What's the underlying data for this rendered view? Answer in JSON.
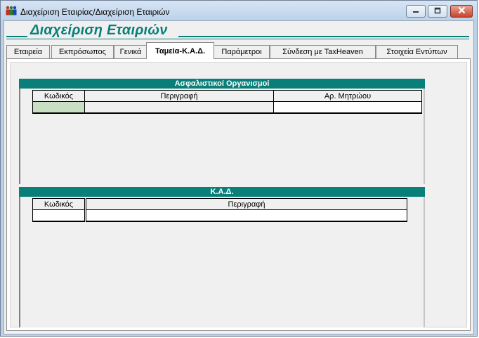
{
  "window": {
    "title": "Διαχείριση Εταιρίας/Διαχείριση Εταιριών"
  },
  "header": {
    "title": "Διαχείριση Εταιριών"
  },
  "tabs": [
    {
      "label": "Εταιρεία"
    },
    {
      "label": "Εκπρόσωπος"
    },
    {
      "label": "Γενικά"
    },
    {
      "label": "Ταμεία-Κ.Α.Δ."
    },
    {
      "label": "Παράμετροι"
    },
    {
      "label": "Σύνδεση με TaxHeaven"
    },
    {
      "label": "Στοιχεία Εντύπων"
    }
  ],
  "active_tab": "Ταμεία-Κ.Α.Δ.",
  "insurance_grid": {
    "caption": "Ασφαλιστικοί Οργανισμοί",
    "columns": [
      "Κωδικός",
      "Περιγραφή",
      "Αρ. Μητρώου"
    ],
    "rows": [
      [
        "",
        "",
        ""
      ]
    ]
  },
  "kad_grid": {
    "caption": "Κ.Α.Δ.",
    "columns": [
      "Κωδικός",
      "Περιγραφή"
    ],
    "rows": [
      [
        "",
        ""
      ]
    ]
  },
  "colors": {
    "accent": "#0a7f7a",
    "selected_cell": "#c9dfc4"
  },
  "icons": {
    "app": "users-group-icon",
    "minimize": "minimize-icon",
    "maximize": "maximize-icon",
    "close": "close-icon"
  }
}
